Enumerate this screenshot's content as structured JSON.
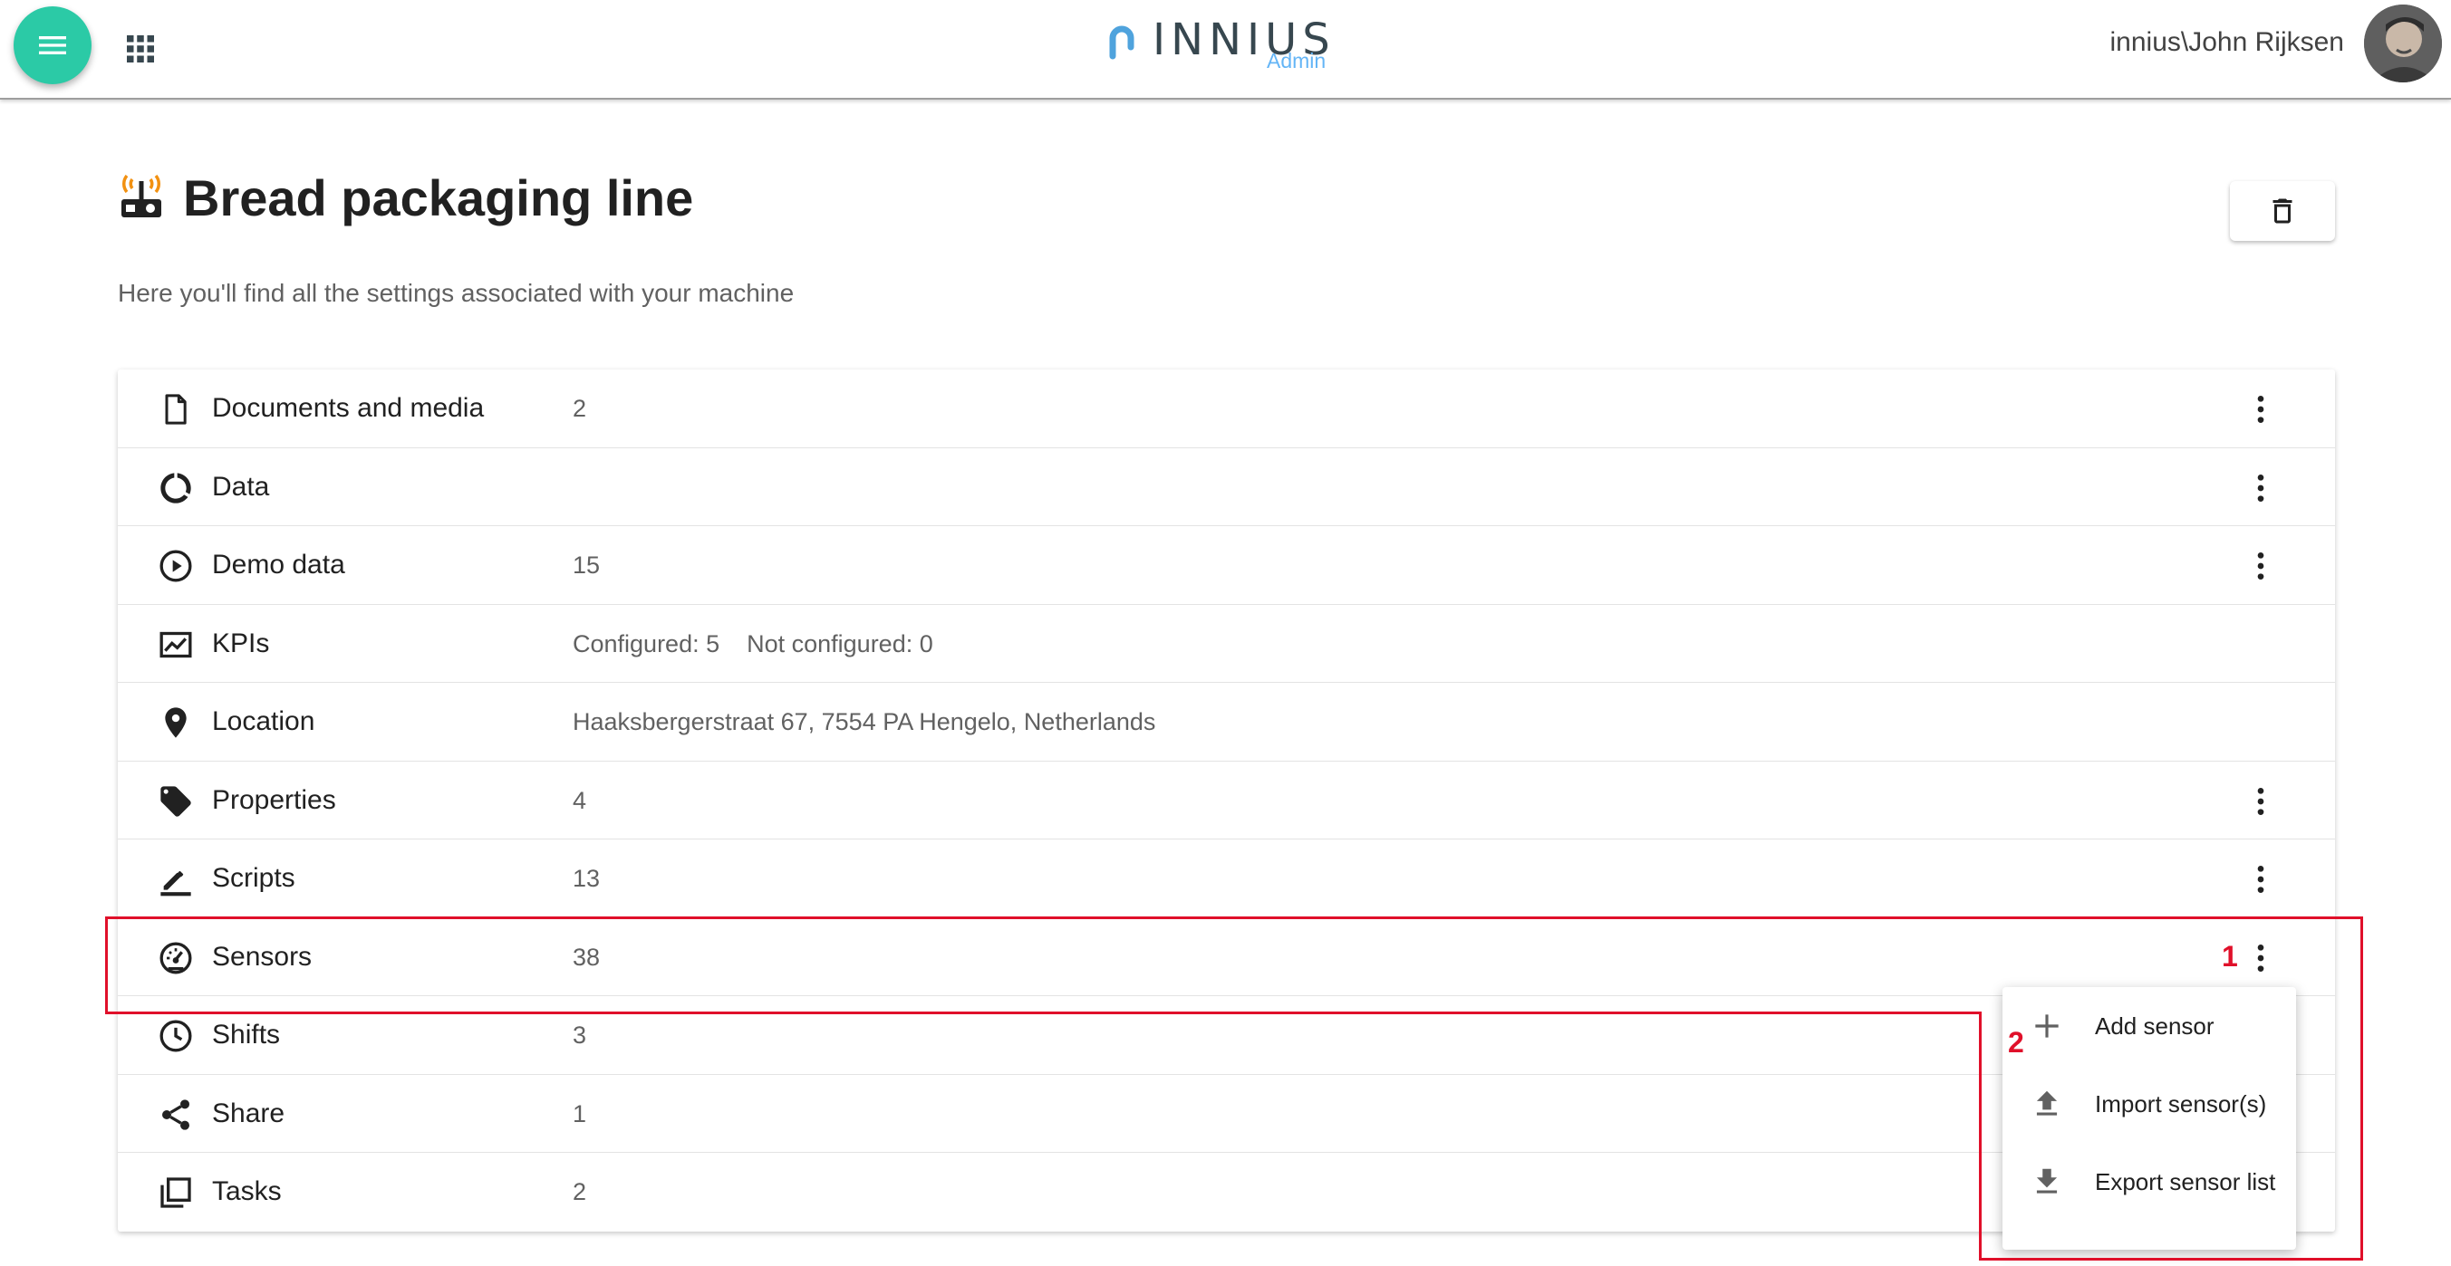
{
  "header": {
    "logo_text": "INNIUS",
    "logo_sub": "Admin",
    "user": "innius\\John Rijksen",
    "menu_icon": "hamburger-icon",
    "apps_icon": "apps-grid-icon"
  },
  "page": {
    "title": "Bread packaging line",
    "subtitle": "Here you'll find all the settings associated with your machine",
    "icon": "machine-icon"
  },
  "colors": {
    "accent": "#2bcaa6",
    "annotation": "#e0102a",
    "logo_sub": "#64b5f6"
  },
  "settings": [
    {
      "label": "Documents and media",
      "value": "2",
      "icon": "document-icon"
    },
    {
      "label": "Data",
      "value": "",
      "icon": "data-ring-icon"
    },
    {
      "label": "Demo data",
      "value": "15",
      "icon": "play-circle-icon"
    },
    {
      "label": "KPIs",
      "value": "Configured: 5    Not configured: 0",
      "icon": "trend-chart-icon"
    },
    {
      "label": "Location",
      "value": "Haaksbergerstraat 67, 7554 PA Hengelo, Netherlands",
      "icon": "location-pin-icon"
    },
    {
      "label": "Properties",
      "value": "4",
      "icon": "tag-icon"
    },
    {
      "label": "Scripts",
      "value": "13",
      "icon": "pencil-icon"
    },
    {
      "label": "Sensors",
      "value": "38",
      "icon": "gauge-icon"
    },
    {
      "label": "Shifts",
      "value": "3",
      "icon": "clock-icon"
    },
    {
      "label": "Share",
      "value": "1",
      "icon": "share-icon"
    },
    {
      "label": "Tasks",
      "value": "2",
      "icon": "tasks-icon"
    }
  ],
  "menu": {
    "items": [
      {
        "label": "Add sensor",
        "icon": "plus-icon"
      },
      {
        "label": "Import sensor(s)",
        "icon": "upload-icon"
      },
      {
        "label": "Export sensor list",
        "icon": "download-icon"
      }
    ]
  },
  "annotations": {
    "step1": "1",
    "step2": "2"
  }
}
